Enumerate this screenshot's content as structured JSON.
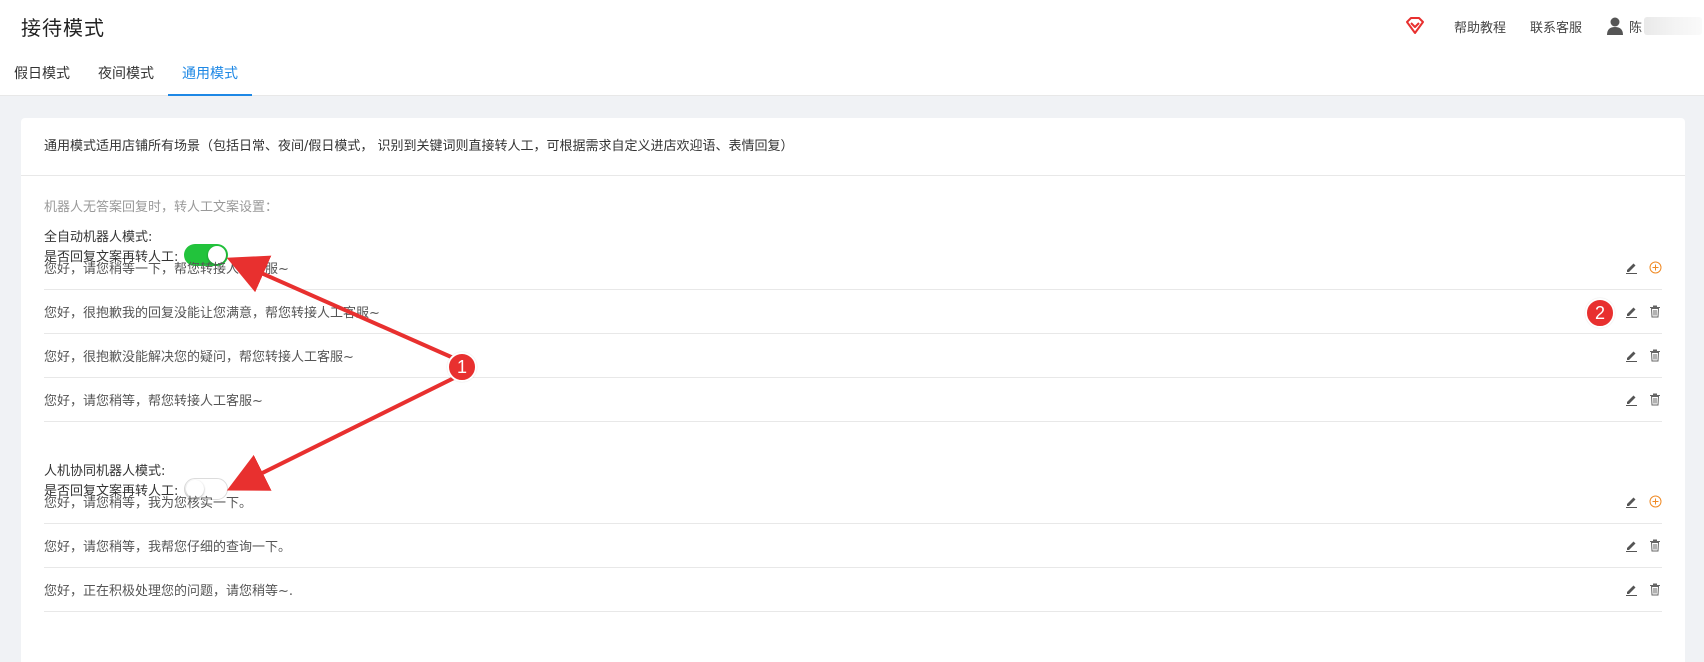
{
  "header": {
    "title": "接待模式",
    "help_link": "帮助教程",
    "contact_link": "联系客服",
    "user_name_prefix": "陈"
  },
  "tabs": [
    {
      "label": "假日模式",
      "active": false
    },
    {
      "label": "夜间模式",
      "active": false
    },
    {
      "label": "通用模式",
      "active": true
    }
  ],
  "card": {
    "description": "通用模式适用店铺所有场景（包括日常、夜间/假日模式， 识别到关键词则直接转人工，可根据需求自定义进店欢迎语、表情回复）",
    "hint": "机器人无答案回复时，转人工文案设置："
  },
  "full_auto": {
    "mode_label": "全自动机器人模式:",
    "toggle_label": "是否回复文案再转人工:",
    "toggle_on": true,
    "replies": [
      "您好，请您稍等一下，帮您转接人工客服~",
      "您好，很抱歉我的回复没能让您满意，帮您转接人工客服~",
      "您好，很抱歉没能解决您的疑问，帮您转接人工客服~",
      "您好，请您稍等，帮您转接人工客服~"
    ]
  },
  "collab": {
    "mode_label": "人机协同机器人模式:",
    "toggle_label": "是否回复文案再转人工:",
    "toggle_on": false,
    "replies": [
      "您好，请您稍等，我为您核实一下。",
      "您好，请您稍等，我帮您仔细的查询一下。",
      "您好，正在积极处理您的问题，请您稍等~."
    ]
  },
  "annotations": {
    "badge_1": "1",
    "badge_2": "2",
    "color": "#e8302f"
  },
  "colors": {
    "accent": "#1e88e5",
    "switch_on": "#22c33c",
    "add_icon": "#f08a24"
  }
}
